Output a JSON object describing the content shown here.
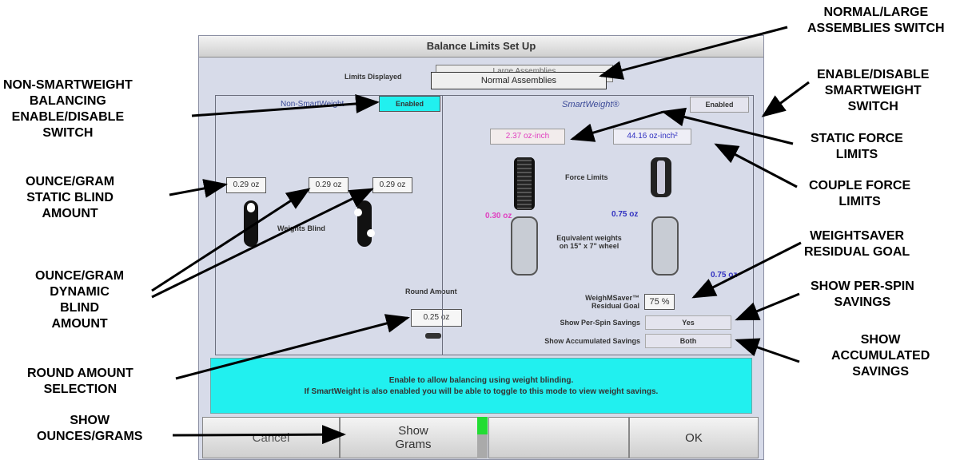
{
  "window": {
    "title": "Balance Limits Set Up"
  },
  "limits_displayed": {
    "label": "Limits Displayed",
    "value": "Normal Assemblies",
    "behind_value": "Large Assemblies"
  },
  "non_smartweight": {
    "label": "Non-SmartWeight",
    "status": "Enabled"
  },
  "smartweight": {
    "label": "SmartWeight®",
    "status": "Enabled"
  },
  "static_blind": {
    "value": "0.29 oz"
  },
  "dynamic_blind": {
    "value1": "0.29 oz",
    "value2": "0.29 oz"
  },
  "weights_blind_label": "Weights Blind",
  "static_force": {
    "value": "2.37 oz-inch"
  },
  "couple_force": {
    "value": "44.16 oz-inch²"
  },
  "force_limits_label": "Force Limits",
  "equiv": {
    "left": "0.30 oz",
    "right_top": "0.75 oz",
    "right_bottom": "0.75 oz",
    "label_line1": "Equivalent weights",
    "label_line2": "on 15\" x 7\" wheel"
  },
  "round_amount": {
    "label": "Round Amount",
    "value": "0.25 oz"
  },
  "weightsaver": {
    "label_line1": "WeighMSaver™",
    "label_line2": "Residual Goal",
    "value": "75 %"
  },
  "per_spin": {
    "label": "Show Per-Spin Savings",
    "value": "Yes"
  },
  "accumulated": {
    "label": "Show Accumulated Savings",
    "value": "Both"
  },
  "message": {
    "line1": "Enable to allow balancing using weight blinding.",
    "line2": "If SmartWeight is also enabled you will be able to toggle to this mode to view weight savings."
  },
  "buttons": {
    "cancel": "Cancel",
    "show_grams_line1": "Show",
    "show_grams_line2": "Grams",
    "ok": "OK"
  },
  "callouts": {
    "normal_large": [
      "NORMAL/LARGE",
      "ASSEMBLIES SWITCH"
    ],
    "enable_smartweight": [
      "ENABLE/DISABLE",
      "SMARTWEIGHT",
      "SWITCH"
    ],
    "static_force": [
      "STATIC FORCE",
      "LIMITS"
    ],
    "couple_force": [
      "COUPLE FORCE",
      "LIMITS"
    ],
    "weightsaver": [
      "WEIGHTSAVER",
      "RESIDUAL GOAL"
    ],
    "per_spin": [
      "SHOW PER-SPIN",
      "SAVINGS"
    ],
    "accumulated": [
      "SHOW",
      "ACCUMULATED",
      "SAVINGS"
    ],
    "non_smartweight": [
      "NON-SMARTWEIGHT",
      "BALANCING",
      "ENABLE/DISABLE",
      "SWITCH"
    ],
    "ounce_static": [
      "OUNCE/GRAM",
      "STATIC BLIND",
      "AMOUNT"
    ],
    "ounce_dynamic": [
      "OUNCE/GRAM",
      "DYNAMIC",
      "BLIND",
      "AMOUNT"
    ],
    "round_amount": [
      "ROUND AMOUNT",
      "SELECTION"
    ],
    "show_ounces": [
      "SHOW",
      "OUNCES/GRAMS"
    ]
  },
  "colors": {
    "screen_bg": "#d7dbe9",
    "message_bg": "#21f0ef",
    "enabled_bg": "#21f0ef",
    "static_force": "#e040c0",
    "couple_force": "#3030c0",
    "indicator": "#22dd33"
  }
}
